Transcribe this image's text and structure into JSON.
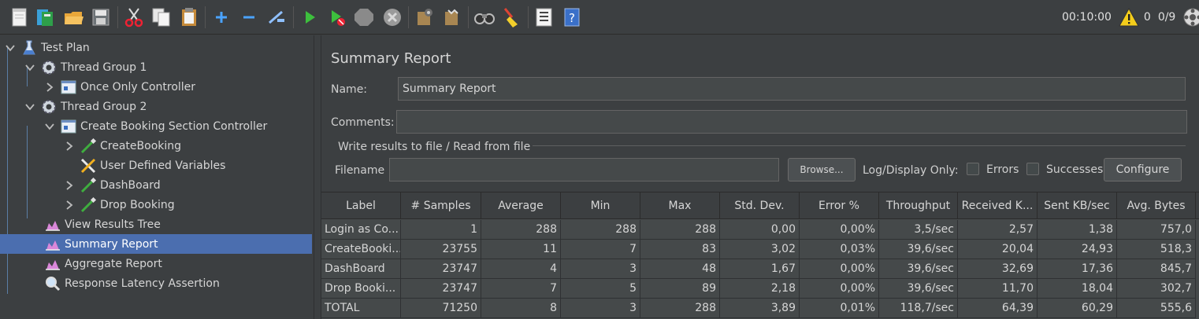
{
  "toolbar": {
    "icons": [
      "new-plan",
      "templates",
      "open",
      "save",
      "cut",
      "copy",
      "paste",
      "expand",
      "collapse",
      "toggle",
      "start",
      "start-no-pauses",
      "stop",
      "shutdown",
      "remote-start-all",
      "remote-stop-all",
      "search",
      "clear-all",
      "function-helper",
      "help"
    ],
    "timer": "00:10:00",
    "warning_count": "0",
    "threads": "0/9"
  },
  "tree": {
    "items": [
      {
        "label": "Test Plan",
        "icon": "flask-icon"
      },
      {
        "label": "Thread Group 1",
        "icon": "gear-icon"
      },
      {
        "label": "Once Only Controller",
        "icon": "controller-icon"
      },
      {
        "label": "Thread Group 2",
        "icon": "gear-icon"
      },
      {
        "label": "Create Booking Section Controller",
        "icon": "controller-icon"
      },
      {
        "label": "CreateBooking",
        "icon": "pipette-icon"
      },
      {
        "label": "User Defined Variables",
        "icon": "tools-icon"
      },
      {
        "label": "DashBoard",
        "icon": "pipette-icon"
      },
      {
        "label": "Drop Booking",
        "icon": "pipette-icon"
      },
      {
        "label": "View Results Tree",
        "icon": "listener-icon"
      },
      {
        "label": "Summary Report",
        "icon": "listener-icon"
      },
      {
        "label": "Aggregate Report",
        "icon": "listener-icon"
      },
      {
        "label": "Response Latency Assertion",
        "icon": "magnifier-icon"
      }
    ],
    "selected": "Summary Report"
  },
  "panel": {
    "title": "Summary Report",
    "name_label": "Name:",
    "name_value": "Summary Report",
    "comments_label": "Comments:",
    "comments_value": "",
    "group_title": "Write results to file / Read from file",
    "filename_label": "Filename",
    "filename_value": "",
    "browse_label": "Browse...",
    "log_display_label": "Log/Display Only:",
    "errors_label": "Errors",
    "successes_label": "Successes",
    "configure_label": "Configure"
  },
  "table": {
    "columns": [
      "Label",
      "# Samples",
      "Average",
      "Min",
      "Max",
      "Std. Dev.",
      "Error %",
      "Throughput",
      "Received K...",
      "Sent KB/sec",
      "Avg. Bytes"
    ],
    "rows": [
      [
        "Login as Co...",
        "1",
        "288",
        "288",
        "288",
        "0,00",
        "0,00%",
        "3,5/sec",
        "2,57",
        "1,38",
        "757,0"
      ],
      [
        "CreateBooki...",
        "23755",
        "11",
        "7",
        "83",
        "3,02",
        "0,03%",
        "39,6/sec",
        "20,04",
        "24,93",
        "518,3"
      ],
      [
        "DashBoard",
        "23747",
        "4",
        "3",
        "48",
        "1,67",
        "0,00%",
        "39,6/sec",
        "32,69",
        "17,36",
        "845,7"
      ],
      [
        "Drop Booki...",
        "23747",
        "7",
        "5",
        "89",
        "2,18",
        "0,00%",
        "39,6/sec",
        "11,70",
        "18,04",
        "302,7"
      ],
      [
        "TOTAL",
        "71250",
        "8",
        "3",
        "288",
        "3,89",
        "0,01%",
        "118,7/sec",
        "64,39",
        "60,29",
        "555,6"
      ]
    ]
  }
}
